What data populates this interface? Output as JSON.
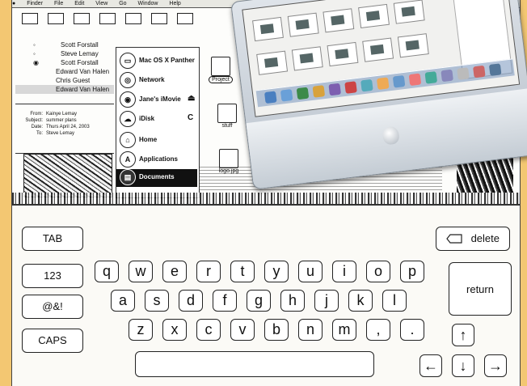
{
  "screenshot": {
    "menubar": [
      "Finder",
      "File",
      "Edit",
      "View",
      "Go",
      "Window",
      "Help"
    ],
    "mail_list": [
      {
        "marker": "◦",
        "name": "Scott Forstall"
      },
      {
        "marker": "◦",
        "name": "Steve Lemay"
      },
      {
        "marker": "◉",
        "name": "Scott Forstall"
      },
      {
        "marker": "",
        "name": "Edward Van Halen"
      },
      {
        "marker": "",
        "name": "Chris Guest"
      },
      {
        "marker": "",
        "name": "Edward Van Halen"
      }
    ],
    "header": {
      "from_label": "From:",
      "from_value": "Kainye Lemay",
      "subject_label": "Subject:",
      "subject_value": "summer plans",
      "date_label": "Date:",
      "date_value": "Thurs April 24, 2003",
      "to_label": "To:",
      "to_value": "Steve Lemay"
    },
    "sidebar": [
      {
        "icon": "drive-icon",
        "label": "Mac OS X Panther",
        "tail": ""
      },
      {
        "icon": "globe-icon",
        "label": "Network",
        "tail": ""
      },
      {
        "icon": "disk-icon",
        "label": "Jane's iMovie",
        "tail": "⏏"
      },
      {
        "icon": "idisk-icon",
        "label": "iDisk",
        "tail": "C"
      },
      {
        "icon": "home-icon",
        "label": "Home",
        "tail": ""
      },
      {
        "icon": "applications-icon",
        "label": "Applications",
        "tail": ""
      },
      {
        "icon": "documents-icon",
        "label": "Documents",
        "tail": ""
      }
    ],
    "files": [
      {
        "label": "Project"
      },
      {
        "label": "stuff"
      },
      {
        "label": "logo.jpg"
      }
    ]
  },
  "keyboard": {
    "tab": "TAB",
    "delete": "delete",
    "num_toggle": "123",
    "sym_toggle": "@&!",
    "caps": "CAPS",
    "return": "return",
    "row1": [
      "q",
      "w",
      "e",
      "r",
      "t",
      "y",
      "u",
      "i",
      "o",
      "p"
    ],
    "row2": [
      "a",
      "s",
      "d",
      "f",
      "g",
      "h",
      "j",
      "k",
      "l"
    ],
    "row3": [
      "z",
      "x",
      "c",
      "v",
      "b",
      "n",
      "m",
      ",",
      "."
    ],
    "arrows": {
      "up": "↑",
      "left": "←",
      "down": "↓",
      "right": "→"
    },
    "space": ""
  }
}
